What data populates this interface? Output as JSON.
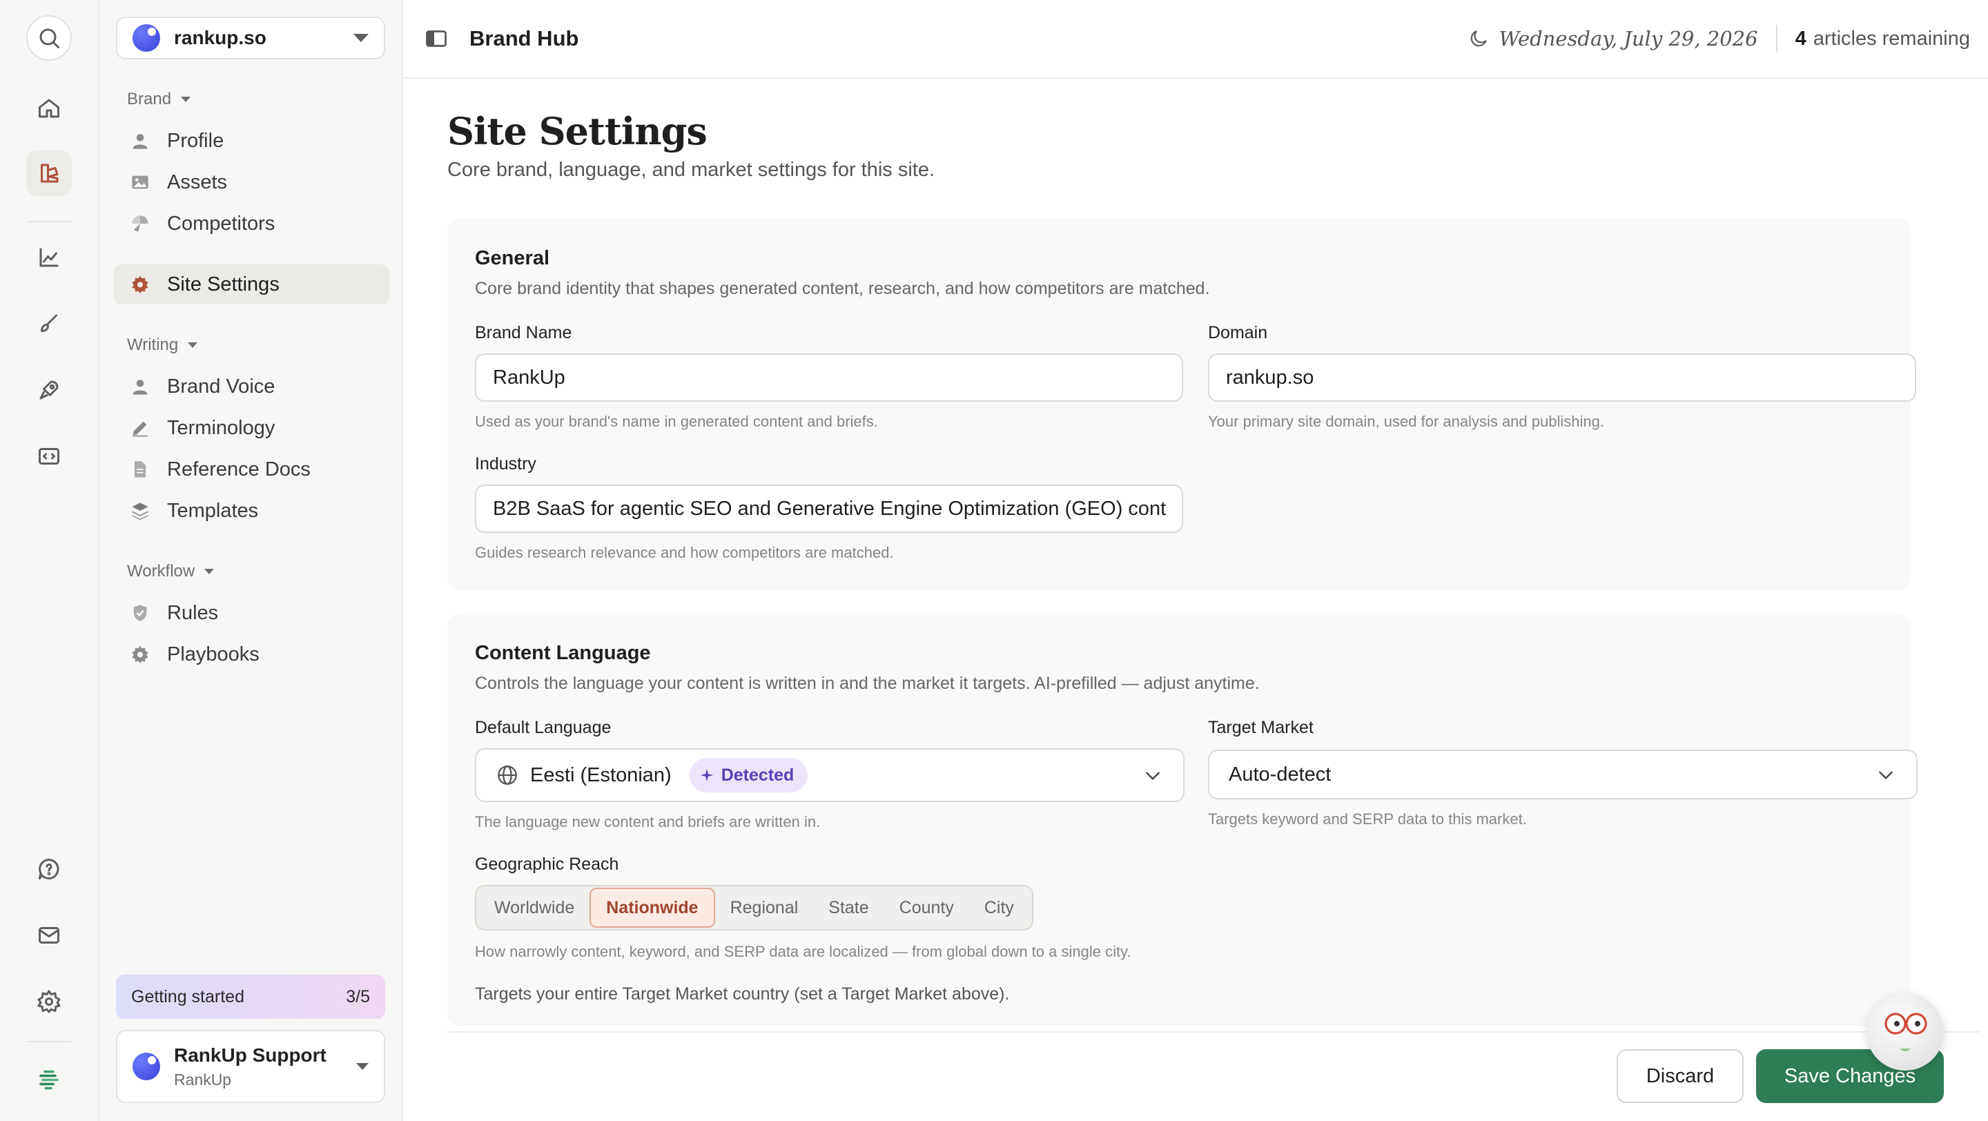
{
  "rail": {
    "items": [
      "search-icon",
      "home-icon",
      "brand-hub-icon",
      "analytics-icon",
      "brush-icon",
      "rocket-icon",
      "embed-icon",
      "chat-icon",
      "mail-icon",
      "gear-icon",
      "logo-icon"
    ],
    "active": "brand-hub-icon",
    "accent_color": "#b0523a"
  },
  "nav": {
    "site_name": "rankup.so",
    "groups": {
      "brand": "Brand",
      "writing": "Writing",
      "workflow": "Workflow"
    },
    "items": {
      "profile": "Profile",
      "assets": "Assets",
      "competitors": "Competitors",
      "site_settings": "Site Settings",
      "brand_voice": "Brand Voice",
      "terminology": "Terminology",
      "reference_docs": "Reference Docs",
      "templates": "Templates",
      "rules": "Rules",
      "playbooks": "Playbooks"
    },
    "getting_started": {
      "label": "Getting started",
      "progress": "3/5"
    },
    "account": {
      "name": "RankUp Support",
      "org": "RankUp"
    }
  },
  "topbar": {
    "title": "Brand Hub",
    "date": "Wednesday, July 29, 2026",
    "remaining_count": "4",
    "remaining_label": "articles remaining"
  },
  "page": {
    "title": "Site Settings",
    "subtitle": "Core brand, language, and market settings for this site."
  },
  "general": {
    "heading": "General",
    "description": "Core brand identity that shapes generated content, research, and how competitors are matched.",
    "brand_name": {
      "label": "Brand Name",
      "value": "RankUp",
      "hint": "Used as your brand's name in generated content and briefs."
    },
    "domain": {
      "label": "Domain",
      "value": "rankup.so",
      "hint": "Your primary site domain, used for analysis and publishing."
    },
    "industry": {
      "label": "Industry",
      "value": "B2B SaaS for agentic SEO and Generative Engine Optimization (GEO) cont",
      "hint": "Guides research relevance and how competitors are matched."
    }
  },
  "content_language": {
    "heading": "Content Language",
    "description": "Controls the language your content is written in and the market it targets. AI-prefilled — adjust anytime.",
    "default_language": {
      "label": "Default Language",
      "value": "Eesti (Estonian)",
      "badge": "Detected",
      "hint": "The language new content and briefs are written in."
    },
    "target_market": {
      "label": "Target Market",
      "value": "Auto-detect",
      "hint": "Targets keyword and SERP data to this market."
    },
    "geographic_reach": {
      "label": "Geographic Reach",
      "options": [
        "Worldwide",
        "Nationwide",
        "Regional",
        "State",
        "County",
        "City"
      ],
      "selected": "Nationwide",
      "hint": "How narrowly content, keyword, and SERP data are localized — from global down to a single city.",
      "note": "Targets your entire Target Market country (set a Target Market above)."
    }
  },
  "footer": {
    "discard": "Discard",
    "save": "Save Changes",
    "save_color": "#2f7d57"
  }
}
